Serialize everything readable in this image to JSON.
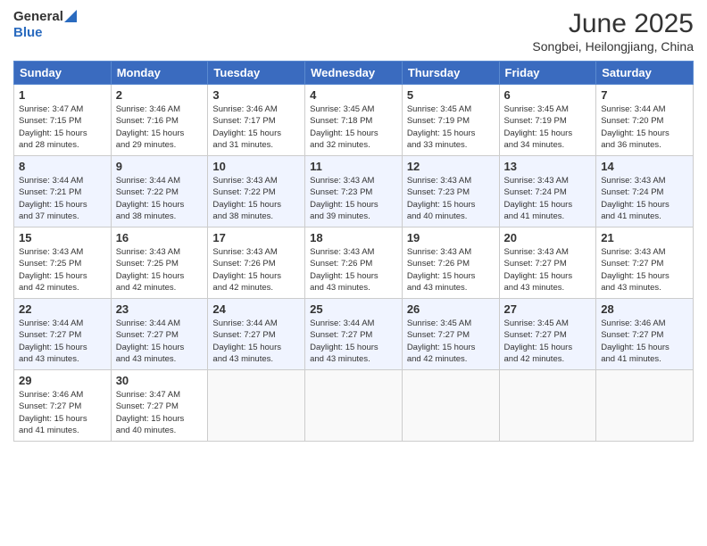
{
  "logo": {
    "general": "General",
    "blue": "Blue"
  },
  "title": "June 2025",
  "subtitle": "Songbei, Heilongjiang, China",
  "days_of_week": [
    "Sunday",
    "Monday",
    "Tuesday",
    "Wednesday",
    "Thursday",
    "Friday",
    "Saturday"
  ],
  "weeks": [
    [
      {
        "day": "1",
        "sunrise": "3:47 AM",
        "sunset": "7:15 PM",
        "daylight": "15 hours and 28 minutes."
      },
      {
        "day": "2",
        "sunrise": "3:46 AM",
        "sunset": "7:16 PM",
        "daylight": "15 hours and 29 minutes."
      },
      {
        "day": "3",
        "sunrise": "3:46 AM",
        "sunset": "7:17 PM",
        "daylight": "15 hours and 31 minutes."
      },
      {
        "day": "4",
        "sunrise": "3:45 AM",
        "sunset": "7:18 PM",
        "daylight": "15 hours and 32 minutes."
      },
      {
        "day": "5",
        "sunrise": "3:45 AM",
        "sunset": "7:19 PM",
        "daylight": "15 hours and 33 minutes."
      },
      {
        "day": "6",
        "sunrise": "3:45 AM",
        "sunset": "7:19 PM",
        "daylight": "15 hours and 34 minutes."
      },
      {
        "day": "7",
        "sunrise": "3:44 AM",
        "sunset": "7:20 PM",
        "daylight": "15 hours and 36 minutes."
      }
    ],
    [
      {
        "day": "8",
        "sunrise": "3:44 AM",
        "sunset": "7:21 PM",
        "daylight": "15 hours and 37 minutes."
      },
      {
        "day": "9",
        "sunrise": "3:44 AM",
        "sunset": "7:22 PM",
        "daylight": "15 hours and 38 minutes."
      },
      {
        "day": "10",
        "sunrise": "3:43 AM",
        "sunset": "7:22 PM",
        "daylight": "15 hours and 38 minutes."
      },
      {
        "day": "11",
        "sunrise": "3:43 AM",
        "sunset": "7:23 PM",
        "daylight": "15 hours and 39 minutes."
      },
      {
        "day": "12",
        "sunrise": "3:43 AM",
        "sunset": "7:23 PM",
        "daylight": "15 hours and 40 minutes."
      },
      {
        "day": "13",
        "sunrise": "3:43 AM",
        "sunset": "7:24 PM",
        "daylight": "15 hours and 41 minutes."
      },
      {
        "day": "14",
        "sunrise": "3:43 AM",
        "sunset": "7:24 PM",
        "daylight": "15 hours and 41 minutes."
      }
    ],
    [
      {
        "day": "15",
        "sunrise": "3:43 AM",
        "sunset": "7:25 PM",
        "daylight": "15 hours and 42 minutes."
      },
      {
        "day": "16",
        "sunrise": "3:43 AM",
        "sunset": "7:25 PM",
        "daylight": "15 hours and 42 minutes."
      },
      {
        "day": "17",
        "sunrise": "3:43 AM",
        "sunset": "7:26 PM",
        "daylight": "15 hours and 42 minutes."
      },
      {
        "day": "18",
        "sunrise": "3:43 AM",
        "sunset": "7:26 PM",
        "daylight": "15 hours and 43 minutes."
      },
      {
        "day": "19",
        "sunrise": "3:43 AM",
        "sunset": "7:26 PM",
        "daylight": "15 hours and 43 minutes."
      },
      {
        "day": "20",
        "sunrise": "3:43 AM",
        "sunset": "7:27 PM",
        "daylight": "15 hours and 43 minutes."
      },
      {
        "day": "21",
        "sunrise": "3:43 AM",
        "sunset": "7:27 PM",
        "daylight": "15 hours and 43 minutes."
      }
    ],
    [
      {
        "day": "22",
        "sunrise": "3:44 AM",
        "sunset": "7:27 PM",
        "daylight": "15 hours and 43 minutes."
      },
      {
        "day": "23",
        "sunrise": "3:44 AM",
        "sunset": "7:27 PM",
        "daylight": "15 hours and 43 minutes."
      },
      {
        "day": "24",
        "sunrise": "3:44 AM",
        "sunset": "7:27 PM",
        "daylight": "15 hours and 43 minutes."
      },
      {
        "day": "25",
        "sunrise": "3:44 AM",
        "sunset": "7:27 PM",
        "daylight": "15 hours and 43 minutes."
      },
      {
        "day": "26",
        "sunrise": "3:45 AM",
        "sunset": "7:27 PM",
        "daylight": "15 hours and 42 minutes."
      },
      {
        "day": "27",
        "sunrise": "3:45 AM",
        "sunset": "7:27 PM",
        "daylight": "15 hours and 42 minutes."
      },
      {
        "day": "28",
        "sunrise": "3:46 AM",
        "sunset": "7:27 PM",
        "daylight": "15 hours and 41 minutes."
      }
    ],
    [
      {
        "day": "29",
        "sunrise": "3:46 AM",
        "sunset": "7:27 PM",
        "daylight": "15 hours and 41 minutes."
      },
      {
        "day": "30",
        "sunrise": "3:47 AM",
        "sunset": "7:27 PM",
        "daylight": "15 hours and 40 minutes."
      },
      null,
      null,
      null,
      null,
      null
    ]
  ],
  "labels": {
    "sunrise": "Sunrise:",
    "sunset": "Sunset:",
    "daylight": "Daylight:"
  }
}
